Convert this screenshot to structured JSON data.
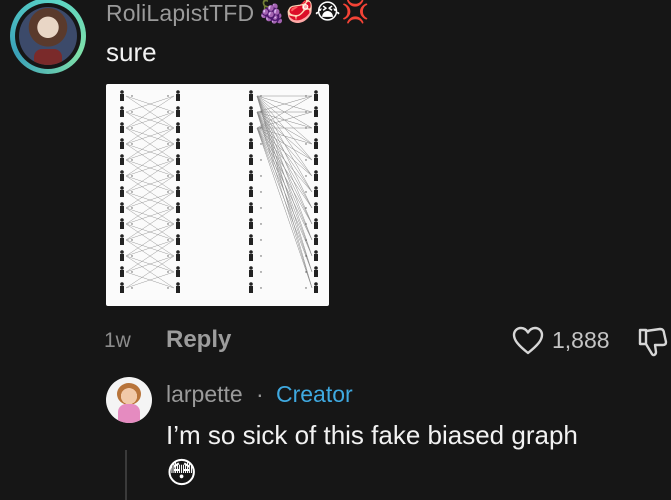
{
  "comment": {
    "username": "RoliLapistTFD",
    "username_emojis": "🍇🥩😭💢",
    "text": "sure",
    "time": "1w",
    "reply_label": "Reply",
    "likes": "1,888"
  },
  "reply": {
    "username": "larpette",
    "separator": "·",
    "badge": "Creator",
    "text": "I’m so sick of this fake biased graph",
    "emoji": "😳"
  },
  "icons": {
    "like": "heart-outline-icon",
    "dislike": "thumbs-down-outline-icon"
  },
  "colors": {
    "background": "#161616",
    "creator_badge": "#3fa9e0",
    "avatar_ring": "#58d2c7"
  }
}
